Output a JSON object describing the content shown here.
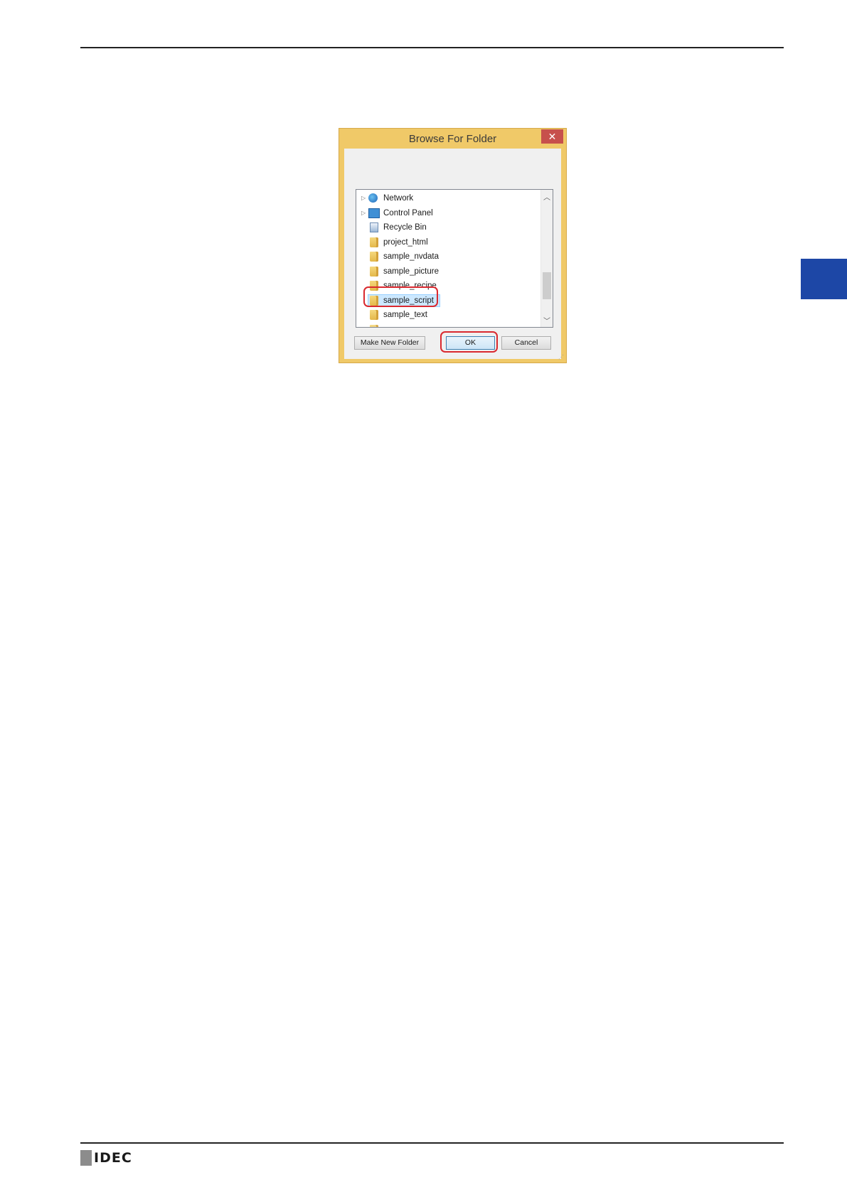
{
  "dialog": {
    "title": "Browse For Folder",
    "close_glyph": "✕",
    "tree_items": [
      {
        "label": "Network",
        "icon": "network-icon",
        "expandable": true
      },
      {
        "label": "Control Panel",
        "icon": "control-panel-icon",
        "expandable": true
      },
      {
        "label": "Recycle Bin",
        "icon": "recycle-bin-icon",
        "expandable": false
      },
      {
        "label": "project_html",
        "icon": "folder-icon",
        "expandable": false
      },
      {
        "label": "sample_nvdata",
        "icon": "folder-icon",
        "expandable": false
      },
      {
        "label": "sample_picture",
        "icon": "folder-icon",
        "expandable": false
      },
      {
        "label": "sample_recipe",
        "icon": "folder-icon",
        "expandable": false
      },
      {
        "label": "sample_script",
        "icon": "folder-icon",
        "expandable": false,
        "selected": true
      },
      {
        "label": "sample_text",
        "icon": "folder-icon",
        "expandable": false
      }
    ],
    "buttons": {
      "make_new_folder": "Make New Folder",
      "ok": "OK",
      "cancel": "Cancel"
    }
  },
  "footer": {
    "logo_text": "IDEC"
  },
  "colors": {
    "accent_tab": "#1d47a6",
    "callout": "#d9292f",
    "dialog_frame": "#f0c968"
  }
}
